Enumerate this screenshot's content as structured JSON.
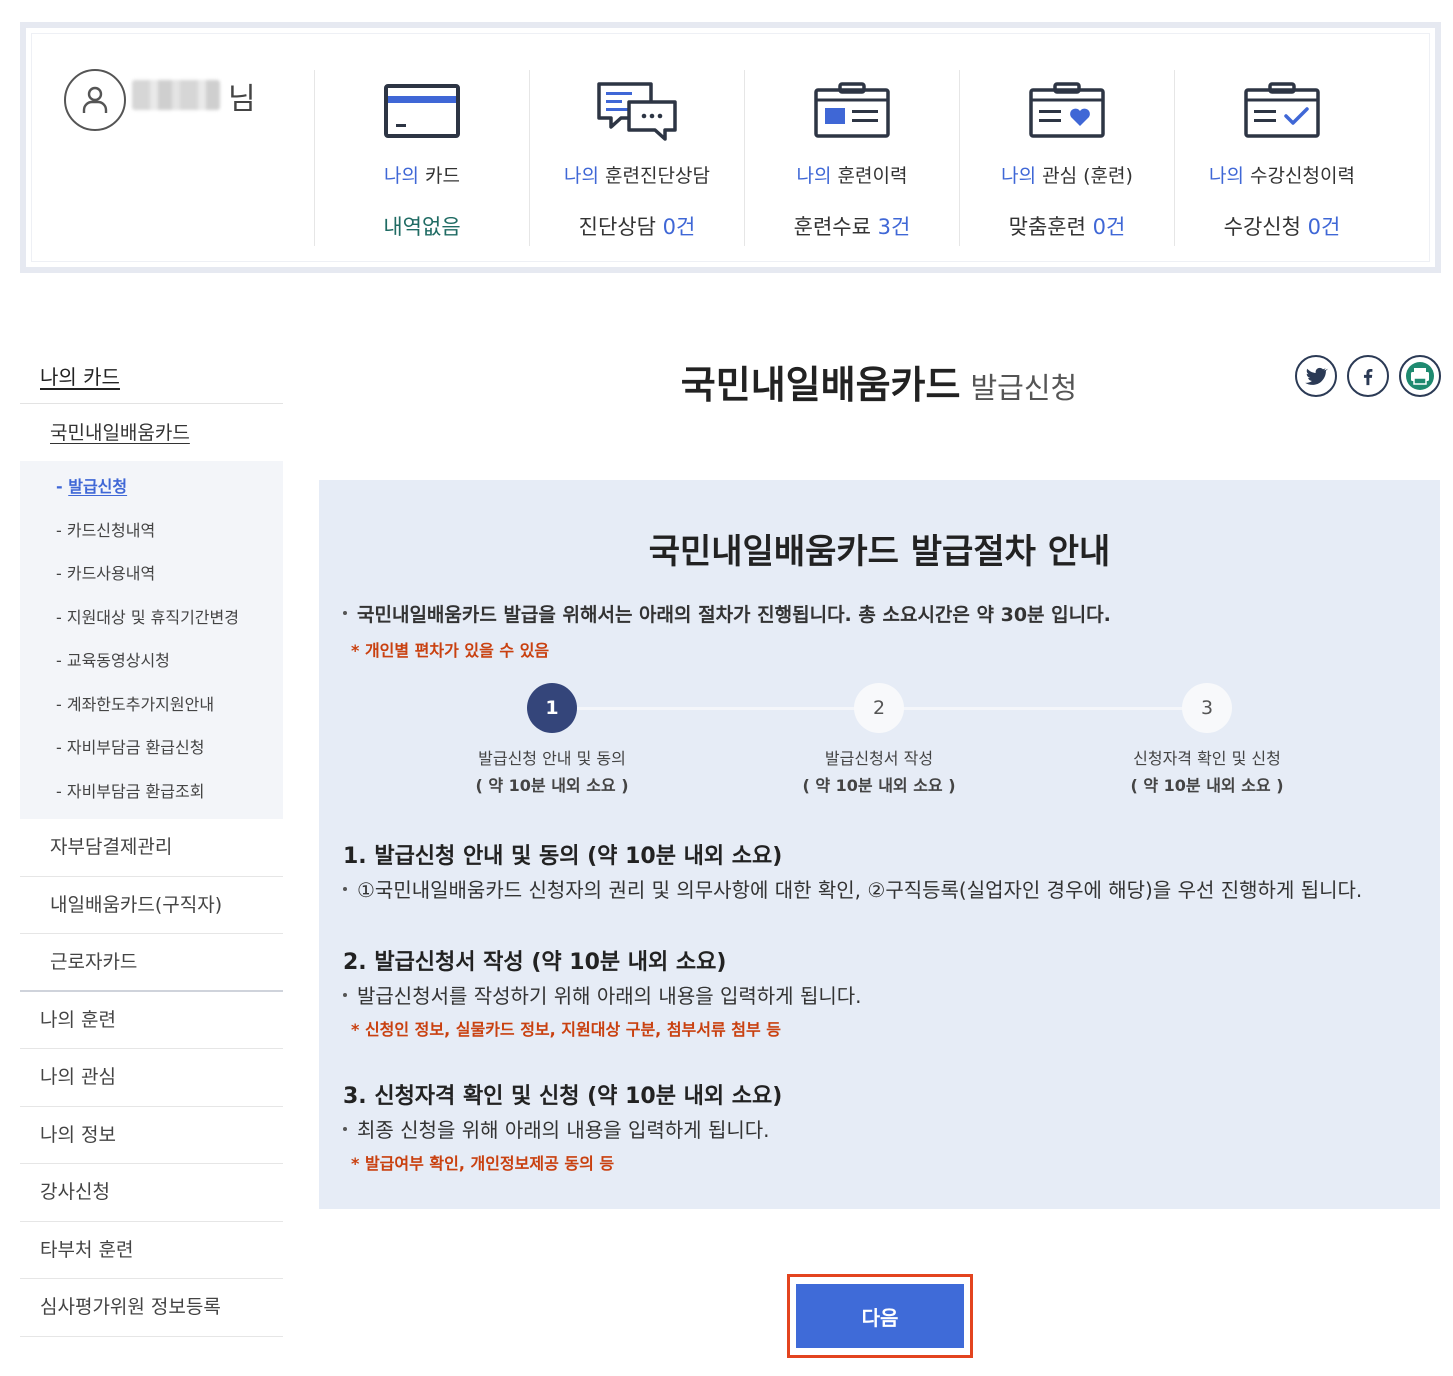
{
  "user": {
    "suffix": "님"
  },
  "summary": [
    {
      "pre": "나의",
      "label": " 카드",
      "value_text": "내역없음",
      "value_num": "",
      "teal": true
    },
    {
      "pre": "나의",
      "label": " 훈련진단상담",
      "value_text": "진단상담 ",
      "value_num": "0건",
      "teal": false
    },
    {
      "pre": "나의",
      "label": " 훈련이력",
      "value_text": "훈련수료 ",
      "value_num": "3건",
      "teal": false
    },
    {
      "pre": "나의",
      "label": " 관심 (훈련)",
      "value_text": "맞춤훈련 ",
      "value_num": "0건",
      "teal": false
    },
    {
      "pre": "나의",
      "label": " 수강신청이력",
      "value_text": "수강신청 ",
      "value_num": "0건",
      "teal": false
    }
  ],
  "sidebar": {
    "title": "나의 카드",
    "sub_title": "국민내일배움카드",
    "submenu": [
      "- 발급신청",
      "- 카드신청내역",
      "- 카드사용내역",
      "- 지원대상 및 휴직기간변경",
      "- 교육동영상시청",
      "- 계좌한도추가지원안내",
      "- 자비부담금 환급신청",
      "- 자비부담금 환급조회"
    ],
    "level2": [
      "자부담결제관리",
      "내일배움카드(구직자)",
      "근로자카드"
    ],
    "level1": [
      "나의 훈련",
      "나의 관심",
      "나의 정보",
      "강사신청",
      "타부처 훈련",
      "심사평가위원 정보등록"
    ]
  },
  "page": {
    "title": "국민내일배움카드",
    "subtitle": "발급신청"
  },
  "guide": {
    "title": "국민내일배움카드 발급절차 안내",
    "intro": "국민내일배움카드 발급을 위해서는 아래의 절차가 진행됩니다. 총 소요시간은 약 30분 입니다.",
    "intro_note": "* 개인별 편차가 있을 수 있음",
    "steps": [
      {
        "num": "1",
        "label": "발급신청 안내 및 동의",
        "dur": "( 약 10분 내외 소요 )"
      },
      {
        "num": "2",
        "label": "발급신청서 작성",
        "dur": "( 약 10분 내외 소요 )"
      },
      {
        "num": "3",
        "label": "신청자격 확인 및 신청",
        "dur": "( 약 10분 내외 소요 )"
      }
    ],
    "sections": [
      {
        "head": "1. 발급신청 안내 및 동의 (약 10분 내외 소요)",
        "text": "①국민내일배움카드 신청자의 권리 및 의무사항에 대한 확인, ②구직등록(실업자인 경우에 해당)을 우선 진행하게 됩니다.",
        "note": ""
      },
      {
        "head": "2. 발급신청서 작성 (약 10분 내외 소요)",
        "text": "발급신청서를 작성하기 위해 아래의 내용을 입력하게 됩니다.",
        "note": "* 신청인 정보, 실물카드 정보, 지원대상 구분, 첨부서류 첨부 등"
      },
      {
        "head": "3. 신청자격 확인 및 신청 (약 10분 내외 소요)",
        "text": "최종 신청을 위해 아래의 내용을 입력하게 됩니다.",
        "note": "* 발급여부 확인, 개인정보제공 동의 등"
      }
    ]
  },
  "next_button": "다음",
  "colors": {
    "accent": "#3f67d6",
    "button": "#3f6bd8",
    "note": "#c9400f",
    "panel": "#e6ecf6",
    "step_active": "#34457a",
    "focus": "#e3441f"
  },
  "icons": [
    "user-icon",
    "card-icon",
    "chat-icon",
    "history-icon",
    "heart-folder-icon",
    "check-folder-icon",
    "twitter-icon",
    "facebook-icon",
    "print-icon"
  ]
}
